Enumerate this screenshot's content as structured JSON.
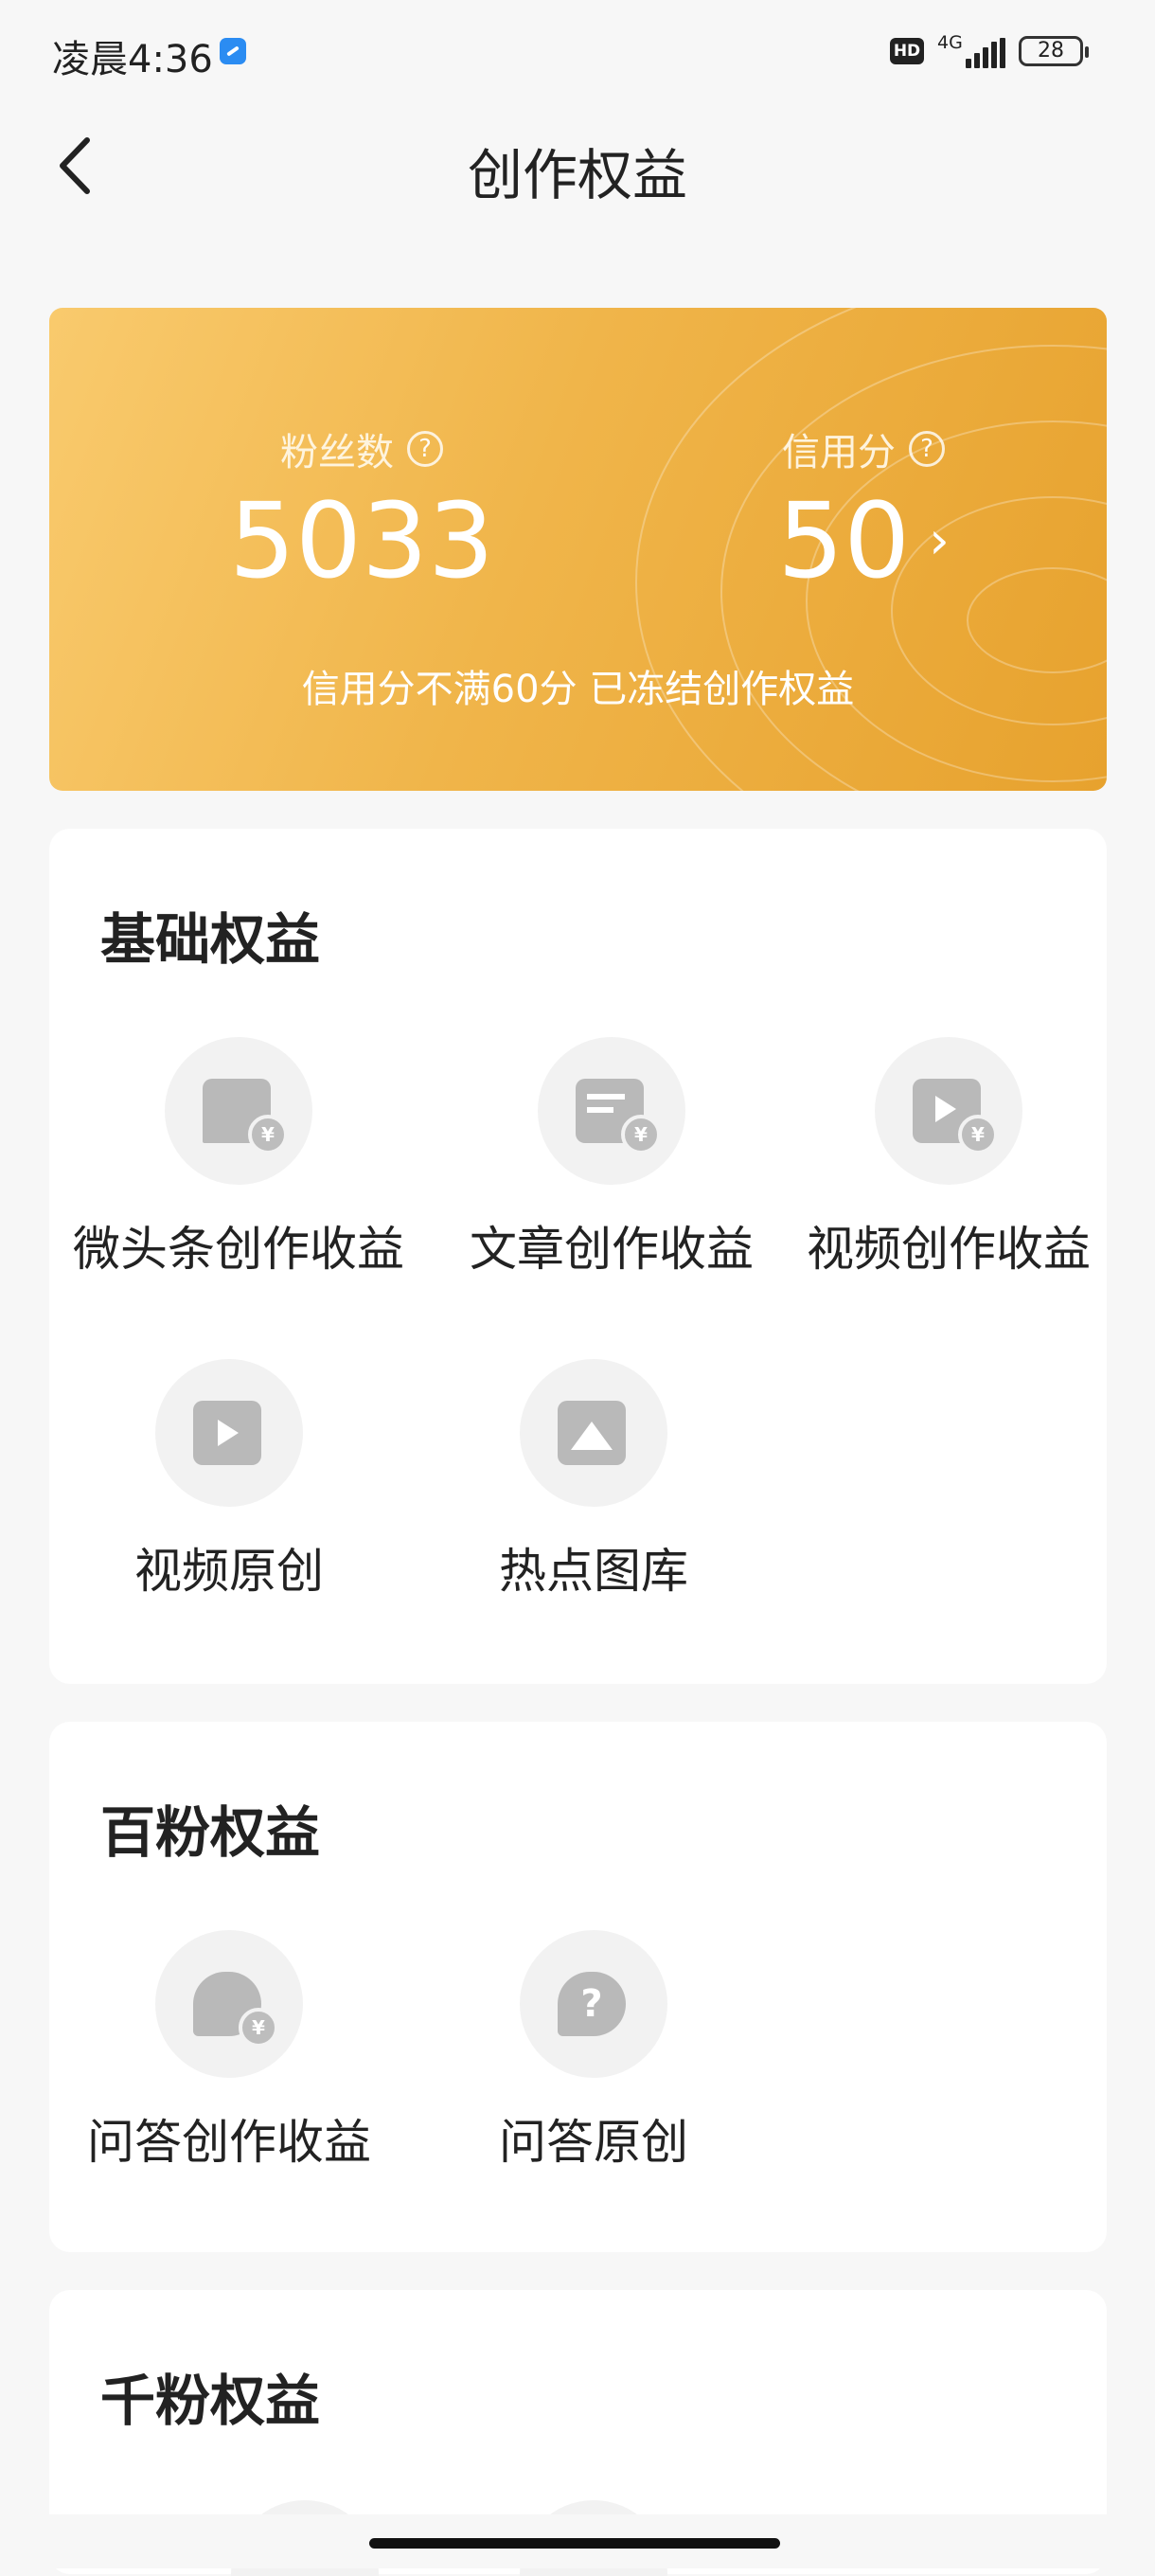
{
  "status_bar": {
    "time": "凌晨4:36",
    "hd_badge": "HD",
    "network": "4G",
    "battery": "28"
  },
  "header": {
    "title": "创作权益"
  },
  "hero": {
    "fans_label": "粉丝数",
    "fans_value": "5033",
    "credit_label": "信用分",
    "credit_value": "50",
    "note": "信用分不满60分 已冻结创作权益",
    "colors": {
      "gradient_start": "#f9ca6d",
      "gradient_end": "#e7a22e"
    }
  },
  "sections": [
    {
      "title": "基础权益",
      "items": [
        {
          "label": "微头条创作收益",
          "icon": "micro-post-income-icon"
        },
        {
          "label": "文章创作收益",
          "icon": "article-income-icon"
        },
        {
          "label": "视频创作收益",
          "icon": "video-income-icon"
        },
        {
          "label": "视频原创",
          "icon": "video-original-icon"
        },
        {
          "label": "热点图库",
          "icon": "image-gallery-icon"
        }
      ]
    },
    {
      "title": "百粉权益",
      "items": [
        {
          "label": "问答创作收益",
          "icon": "qa-income-icon"
        },
        {
          "label": "问答原创",
          "icon": "qa-original-icon"
        }
      ]
    },
    {
      "title": "千粉权益",
      "items": []
    }
  ],
  "icon_glyphs": {
    "currency": "¥",
    "help": "?",
    "back": "‹",
    "chevron": "›"
  }
}
